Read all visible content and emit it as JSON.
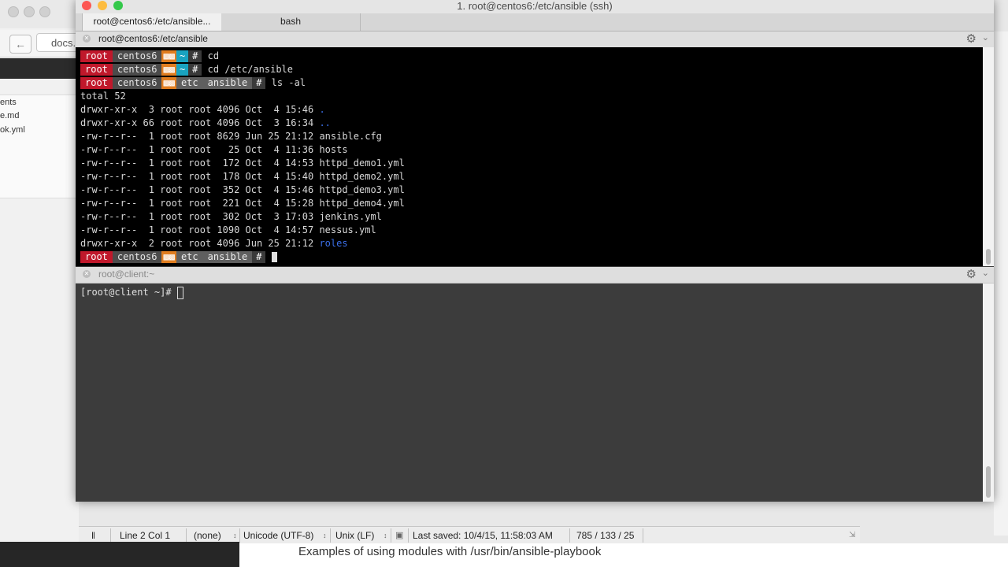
{
  "background_browser": {
    "address_text": "docs.",
    "sidebar_items": [
      "ents",
      "e.md",
      "ok.yml"
    ]
  },
  "window": {
    "title": "1. root@centos6:/etc/ansible (ssh)",
    "tabs": [
      {
        "label": "root@centos6:/etc/ansible..."
      },
      {
        "label": "bash"
      }
    ]
  },
  "pane1": {
    "title": "root@centos6:/etc/ansible",
    "prompt_user": "root",
    "prompt_host": "centos6",
    "prompt_home": "~",
    "prompt_hash": "#",
    "dir1": "etc",
    "dir2": "ansible",
    "commands": [
      "cd",
      "cd /etc/ansible",
      "ls -al"
    ],
    "total": "total 52",
    "listing": [
      {
        "meta": "drwxr-xr-x  3 root root 4096 Oct  4 15:46 ",
        "name": ".",
        "dir": true
      },
      {
        "meta": "drwxr-xr-x 66 root root 4096 Oct  3 16:34 ",
        "name": "..",
        "dir": true
      },
      {
        "meta": "-rw-r--r--  1 root root 8629 Jun 25 21:12 ",
        "name": "ansible.cfg",
        "dir": false
      },
      {
        "meta": "-rw-r--r--  1 root root   25 Oct  4 11:36 ",
        "name": "hosts",
        "dir": false
      },
      {
        "meta": "-rw-r--r--  1 root root  172 Oct  4 14:53 ",
        "name": "httpd_demo1.yml",
        "dir": false
      },
      {
        "meta": "-rw-r--r--  1 root root  178 Oct  4 15:40 ",
        "name": "httpd_demo2.yml",
        "dir": false
      },
      {
        "meta": "-rw-r--r--  1 root root  352 Oct  4 15:46 ",
        "name": "httpd_demo3.yml",
        "dir": false
      },
      {
        "meta": "-rw-r--r--  1 root root  221 Oct  4 15:28 ",
        "name": "httpd_demo4.yml",
        "dir": false
      },
      {
        "meta": "-rw-r--r--  1 root root  302 Oct  3 17:03 ",
        "name": "jenkins.yml",
        "dir": false
      },
      {
        "meta": "-rw-r--r--  1 root root 1090 Oct  4 14:57 ",
        "name": "nessus.yml",
        "dir": false
      },
      {
        "meta": "drwxr-xr-x  2 root root 4096 Jun 25 21:12 ",
        "name": "roles",
        "dir": true
      }
    ]
  },
  "pane2": {
    "title": "root@client:~",
    "prompt": "[root@client ~]# "
  },
  "editor_status": {
    "position": "Line 2 Col 1",
    "syntax": "(none)",
    "encoding": "Unicode (UTF-8)",
    "line_endings": "Unix (LF)",
    "saved": "Last saved: 10/4/15, 11:58:03 AM",
    "counts": "785 / 133 / 25"
  },
  "caption": "Examples of using modules with /usr/bin/ansible-playbook",
  "colors": {
    "close": "#fc5753",
    "minimize": "#fdbc40",
    "zoom": "#34c84a",
    "prompt_user_bg": "#c0182b",
    "dir_link": "#3b6fe8"
  }
}
